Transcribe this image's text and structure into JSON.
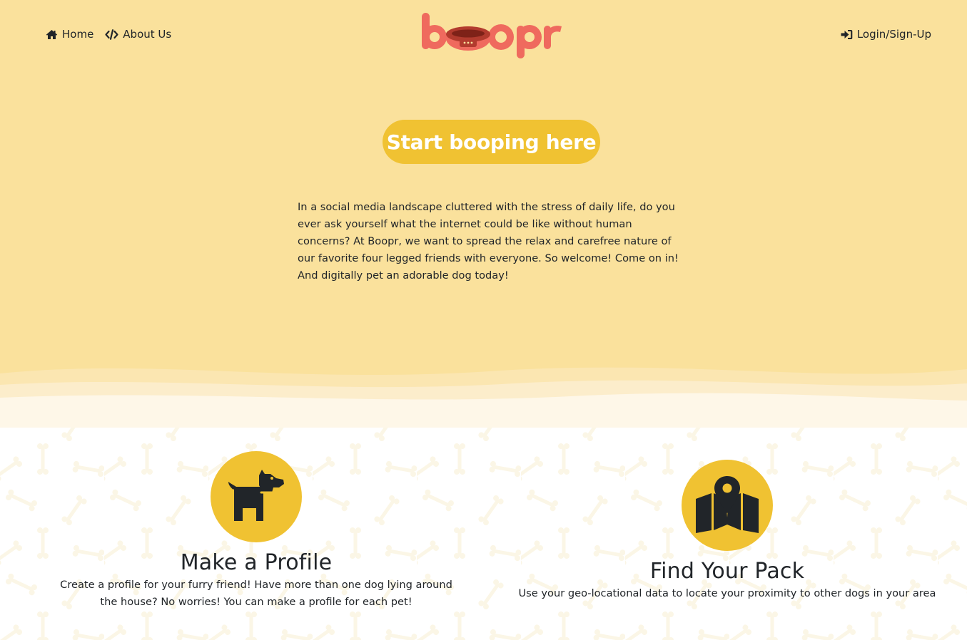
{
  "nav": {
    "home_label": "Home",
    "about_label": "About Us",
    "login_label": "Login/Sign-Up",
    "home_icon": "home-icon",
    "about_icon": "code-icon",
    "login_icon": "sign-in-icon"
  },
  "logo": {
    "text": "boopr",
    "color": "#ef6a5e",
    "collar_color": "#b23b2e"
  },
  "hero": {
    "cta_label": "Start booping here",
    "intro": "In a social media landscape cluttered with the stress of daily life, do you ever ask yourself what the internet could be like without human concerns? At Boopr, we want to spread the relax and carefree nature of our favorite four legged friends with everyone. So welcome! Come on in! And digitally pet an adorable dog today!"
  },
  "features": [
    {
      "icon": "dog-icon",
      "title": "Make a Profile",
      "description": "Create a profile for your furry friend! Have more than one dog lying around the house? No worries! You can make a profile for each pet!"
    },
    {
      "icon": "map-marker-icon",
      "title": "Find Your Pack",
      "description": "Use your geo-locational data to locate your proximity to other dogs in your area"
    }
  ],
  "colors": {
    "hero_background": "#fae19c",
    "accent": "#f0c232",
    "text": "#212529",
    "background": "#ffffff"
  }
}
